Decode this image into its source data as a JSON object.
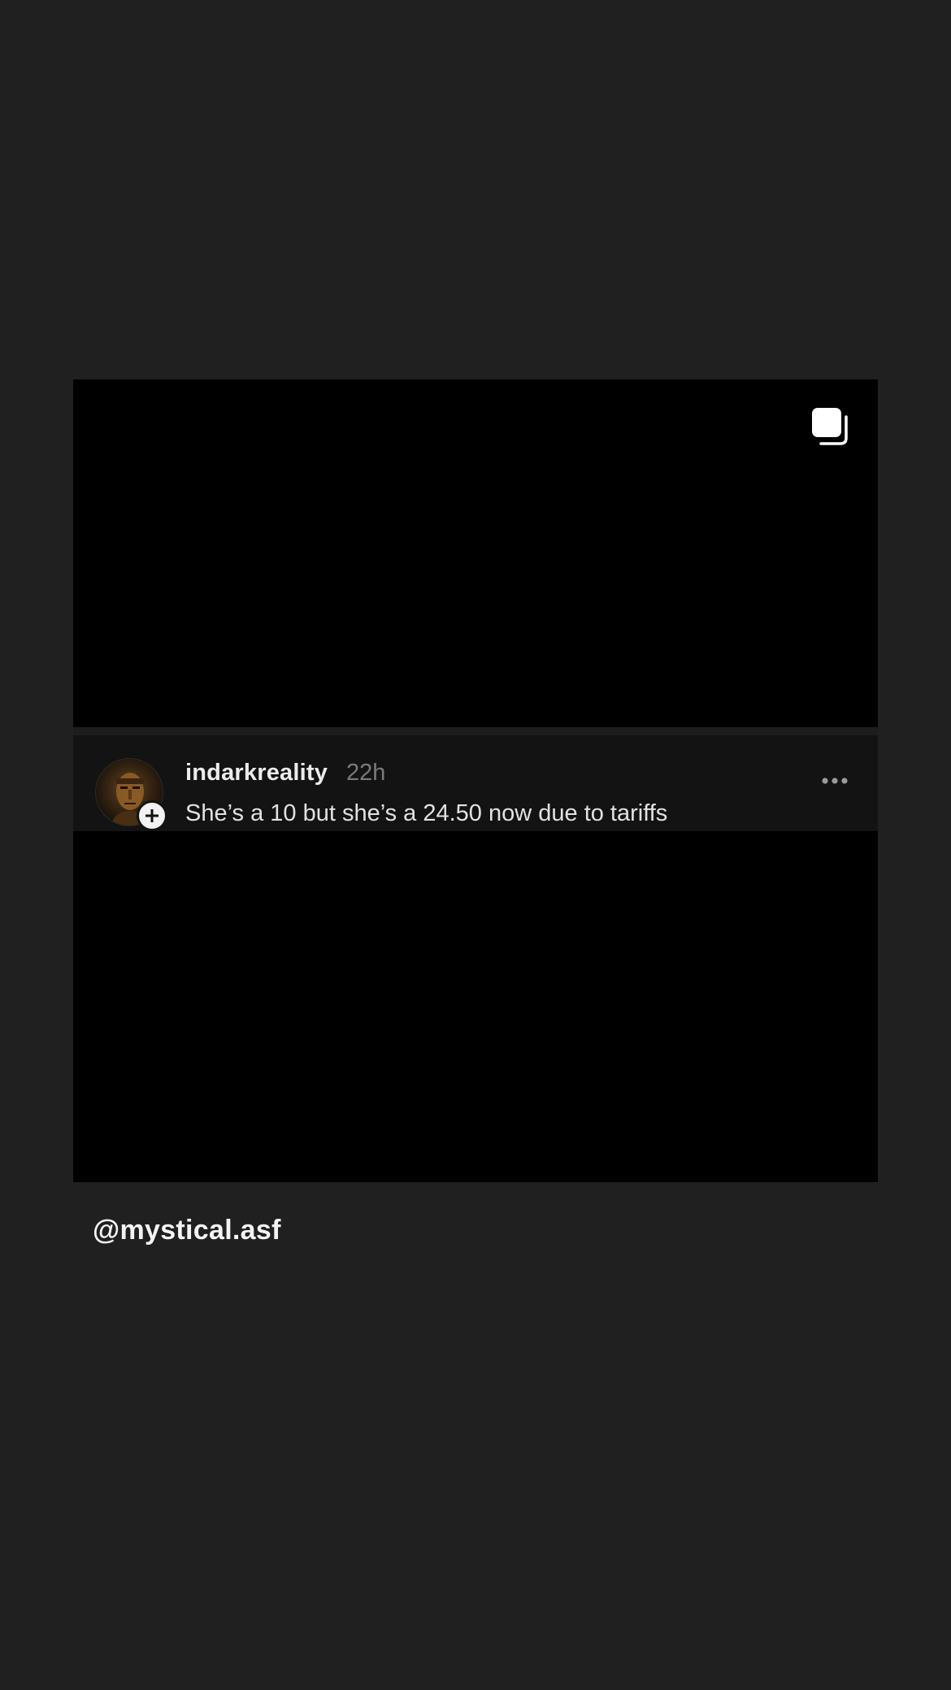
{
  "post": {
    "multi_icon": "multiple-images-icon",
    "thread": {
      "avatar_icon": "profile-avatar",
      "follow_icon": "plus-icon",
      "username": "indarkreality",
      "timestamp": "22h",
      "more_icon": "more-options-icon",
      "text": "She’s a 10 but she’s a 24.50 now due to tariffs"
    }
  },
  "credit": {
    "handle": "@mystical.asf"
  },
  "colors": {
    "page_background": "#202020",
    "card_background": "#000000",
    "strip_background": "#131313",
    "timestamp_gray": "#7a7a7a"
  }
}
